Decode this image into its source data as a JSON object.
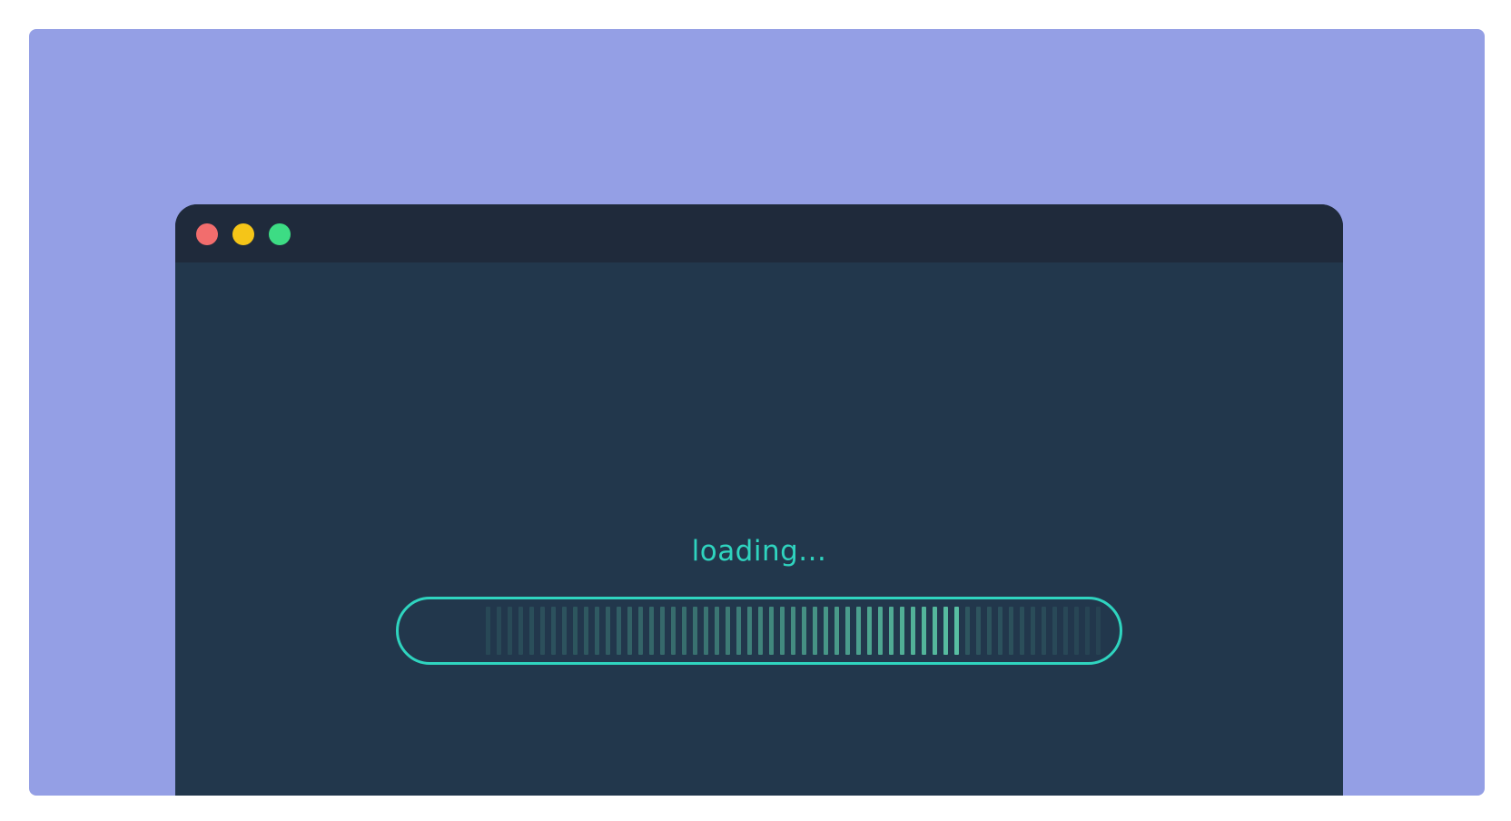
{
  "window": {
    "traffic_lights": [
      {
        "name": "close",
        "color": "#f26d6d"
      },
      {
        "name": "minimize",
        "color": "#f5c518"
      },
      {
        "name": "maximize",
        "color": "#3ddc84"
      }
    ]
  },
  "loader": {
    "label": "loading...",
    "progress": 0.78,
    "accent_color": "#2fd4bf",
    "fill_color": "#5cc9a7"
  }
}
